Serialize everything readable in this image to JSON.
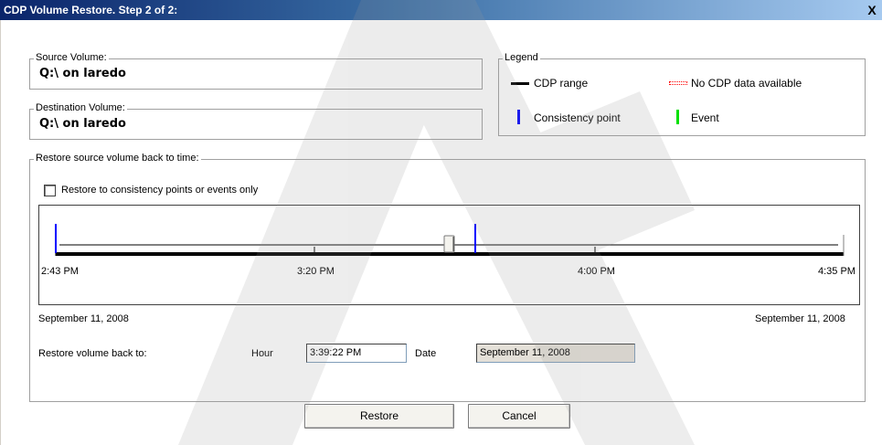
{
  "window": {
    "title": "CDP Volume Restore. Step 2 of 2:",
    "close_label": "X"
  },
  "source": {
    "label": "Source Volume:",
    "value": "Q:\\ on laredo"
  },
  "destination": {
    "label": "Destination Volume:",
    "value": "Q:\\ on laredo"
  },
  "legend": {
    "label": "Legend",
    "items": [
      {
        "label": "CDP range",
        "color": "#000000",
        "icon": "black-line-icon"
      },
      {
        "label": "No CDP data available",
        "color": "#ff0000",
        "icon": "red-dashed-line-icon"
      },
      {
        "label": "Consistency point",
        "color": "#0000ff",
        "icon": "blue-bar-icon"
      },
      {
        "label": "Event",
        "color": "#00e000",
        "icon": "green-bar-icon"
      }
    ]
  },
  "restore_group": {
    "label": "Restore source volume back to time:",
    "checkbox_label": "Restore to consistency points or events only",
    "checkbox_checked": false
  },
  "timeline": {
    "ticks": [
      "2:43 PM",
      "3:20 PM",
      "4:00 PM",
      "4:35 PM"
    ],
    "start_date": "September 11, 2008",
    "end_date": "September 11, 2008",
    "slider_value": "3:39:22 PM"
  },
  "restore_row": {
    "label": "Restore volume back to:",
    "hour_label": "Hour",
    "hour_value": "3:39:22 PM",
    "date_label": "Date",
    "date_value": "September 11, 2008"
  },
  "buttons": {
    "restore": "Restore",
    "cancel": "Cancel"
  }
}
